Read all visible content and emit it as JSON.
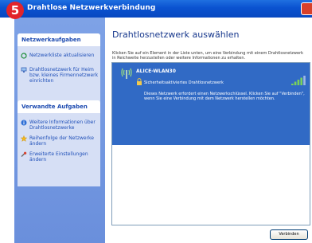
{
  "step_badge": "5",
  "window": {
    "title": "Drahtlose Netzwerkverbindung"
  },
  "sidebar": {
    "network_tasks": {
      "heading": "Netzwerkaufgaben",
      "items": [
        {
          "label": "Netzwerkliste aktualisieren",
          "icon": "refresh-icon"
        },
        {
          "label": "Drahtlosnetzwerk für Heim bzw. kleines Firmennetzwerk einrichten",
          "icon": "network-setup-icon"
        }
      ]
    },
    "related_tasks": {
      "heading": "Verwandte Aufgaben",
      "items": [
        {
          "label": "Weitere Informationen über Drahtlosnetzwerke",
          "icon": "info-icon"
        },
        {
          "label": "Reihenfolge der Netzwerke ändern",
          "icon": "star-icon"
        },
        {
          "label": "Erweiterte Einstellungen ändern",
          "icon": "settings-icon"
        }
      ]
    }
  },
  "main": {
    "title": "Drahtlosnetzwerk auswählen",
    "description": "Klicken Sie auf ein Element in der Liste unten, um eine Verbindung mit einem Drahtlosnetzwerk in Reichweite herzustellen oder weitere Informationen zu erhalten.",
    "network": {
      "name": "ALICE-WLAN30",
      "security": "Sicherheitsaktiviertes Drahtlosnetzwerk",
      "detail": "Dieses Netzwerk erfordert einen Netzwerkschlüssel. Klicken Sie auf \"Verbinden\", wenn Sie eine Verbindung mit dem Netzwerk herstellen möchten.",
      "signal_bars": 4,
      "signal_max": 5
    },
    "connect_label": "Verbinden"
  },
  "colors": {
    "title_bar": "#0a52d0",
    "sidebar": "#7ea2e6",
    "selection": "#316ac5",
    "badge": "#e2242a"
  }
}
